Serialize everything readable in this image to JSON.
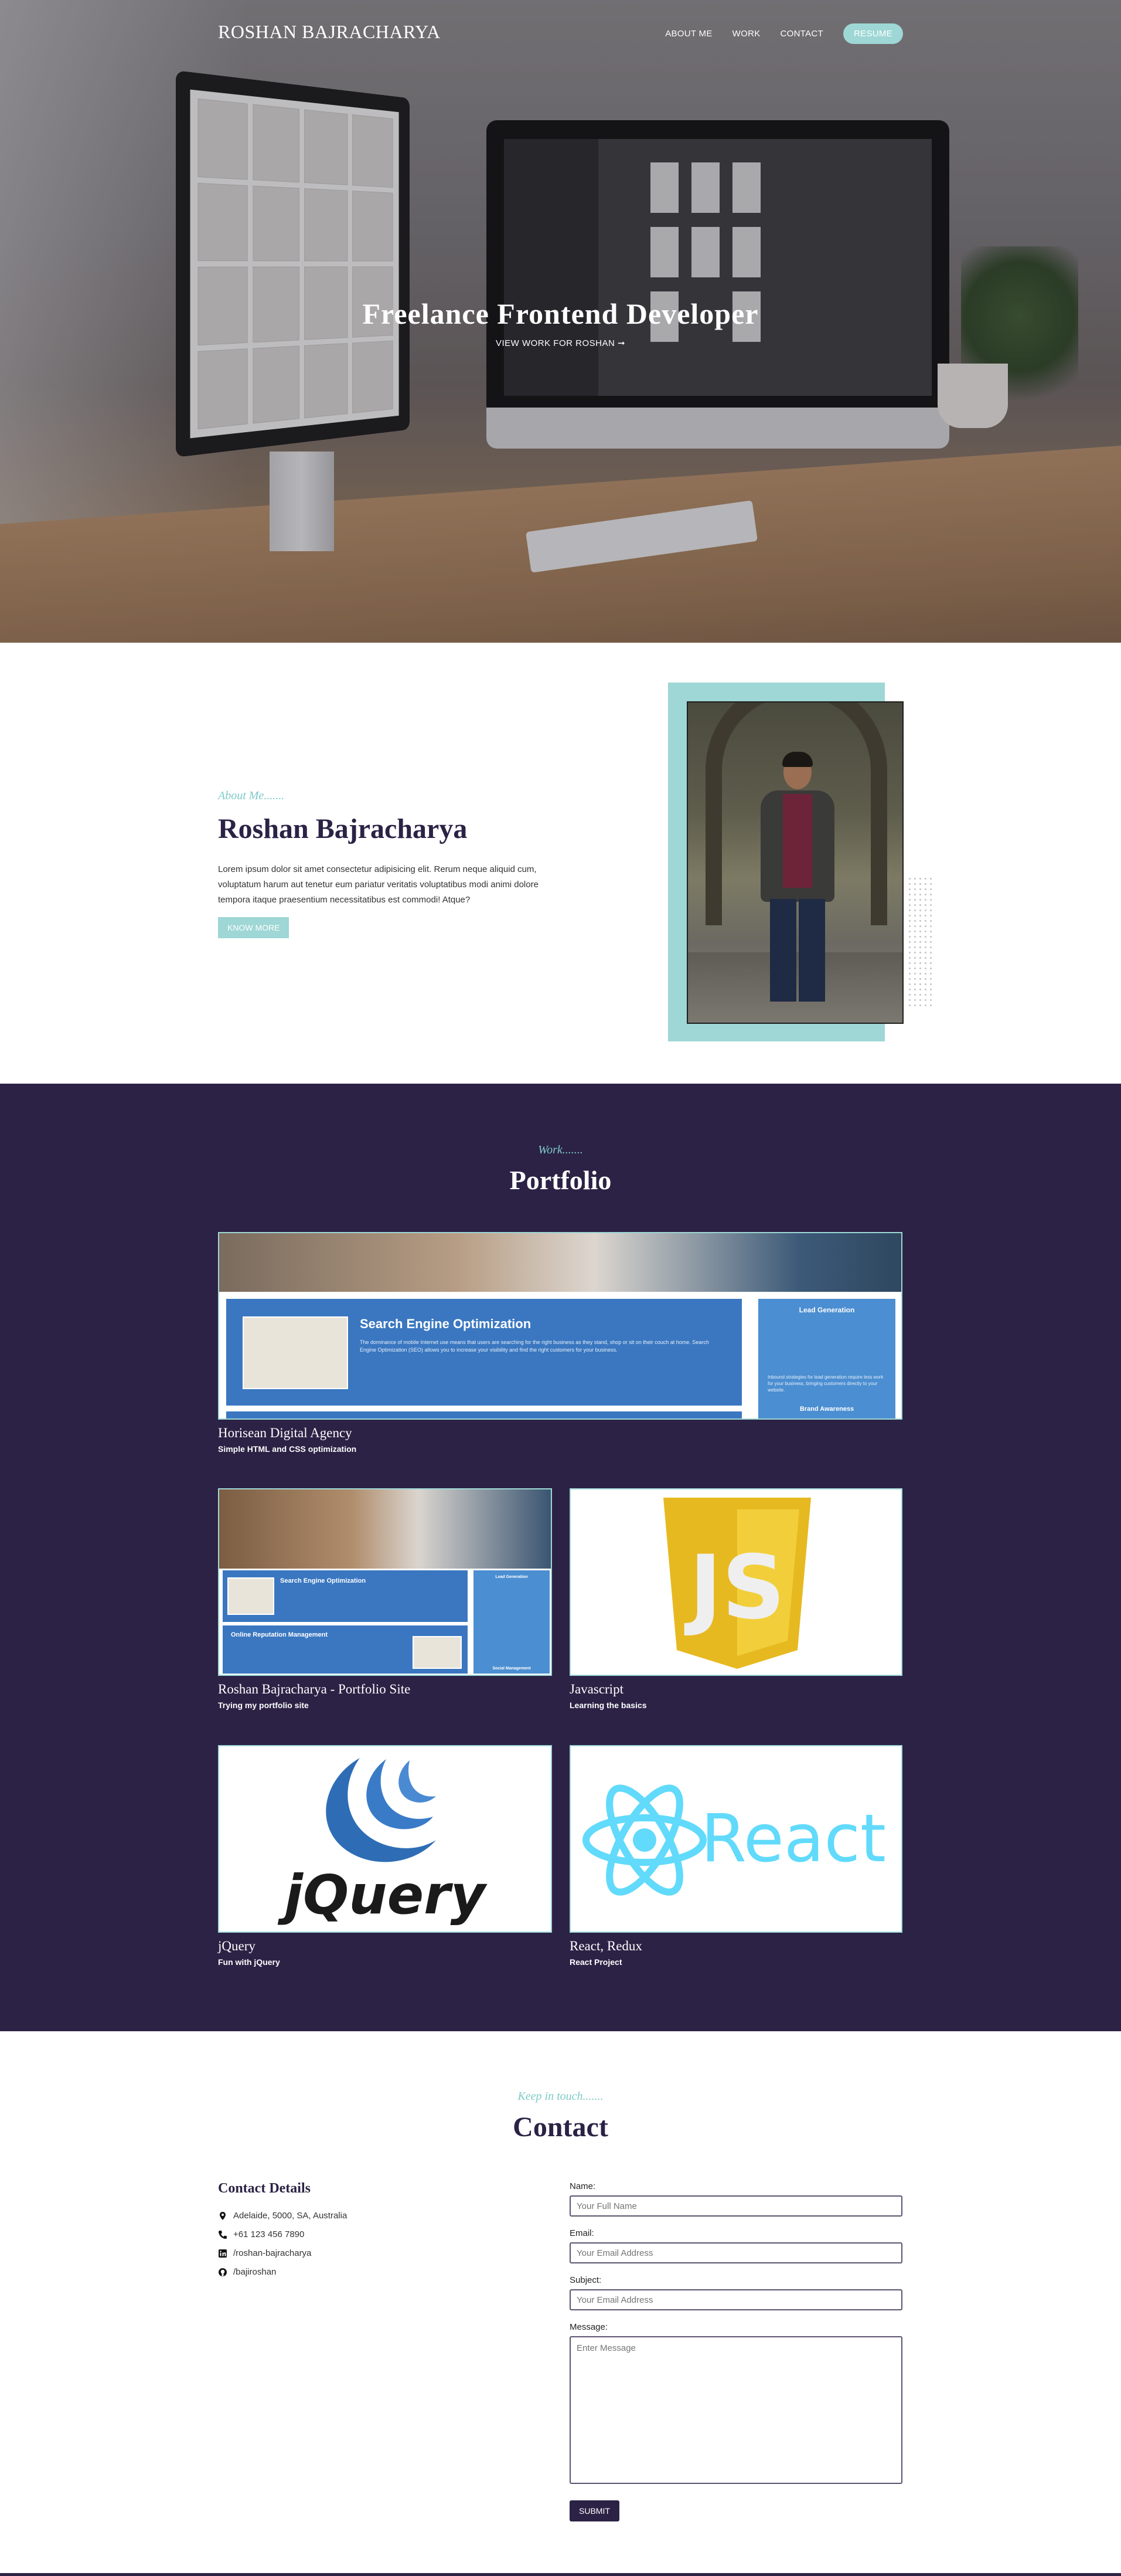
{
  "nav": {
    "brand": "ROSHAN BAJRACHARYA",
    "items": [
      "ABOUT ME",
      "WORK",
      "CONTACT"
    ],
    "resume": "RESUME"
  },
  "hero": {
    "title": "Freelance Frontend Developer",
    "subtitle": "VIEW WORK FOR ROSHAN ➞"
  },
  "about": {
    "kicker": "About Me.......",
    "name": "Roshan Bajracharya",
    "bio": "Lorem ipsum dolor sit amet consectetur adipisicing elit. Rerum neque aliquid cum, voluptatum harum aut tenetur eum pariatur veritatis voluptatibus modi animi dolore tempora itaque praesentium necessitatibus est commodi! Atque?",
    "button": "KNOW MORE"
  },
  "work": {
    "kicker": "Work.......",
    "title": "Portfolio",
    "projects": [
      {
        "title": "Horisean Digital Agency",
        "subtitle": "Simple HTML and CSS optimization"
      },
      {
        "title": "Roshan Bajracharya - Portfolio Site",
        "subtitle": "Trying my portfolio site"
      },
      {
        "title": "Javascript",
        "subtitle": "Learning the basics"
      },
      {
        "title": "jQuery",
        "subtitle": "Fun with jQuery"
      },
      {
        "title": "React, Redux",
        "subtitle": "React Project"
      }
    ],
    "thumb": {
      "seo_title": "Search Engine Optimization",
      "seo_text": "The dominance of mobile Internet use means that users are searching for the right business as they stand, shop or sit on their couch at home. Search Engine Optimization (SEO) allows you to increase your visibility and find the right customers for your business.",
      "lead_title": "Lead Generation",
      "lead_text": "Inbound strategies for lead generation require less work for your business, bringing customers directly to your website.",
      "brand_title": "Brand Awareness",
      "orm_title": "Online Reputation Management",
      "social_title": "Social Management",
      "js_text": "JS",
      "jquery_text": "jQuery",
      "react_text": "React"
    }
  },
  "contact": {
    "kicker": "Keep in touch.......",
    "title": "Contact",
    "details_heading": "Contact Details",
    "address": "Adelaide, 5000, SA, Australia",
    "phone": "+61 123 456 7890",
    "linkedin": "/roshan-bajracharya",
    "github": "/bajiroshan",
    "form": {
      "name_label": "Name:",
      "name_placeholder": "Your Full Name",
      "email_label": "Email:",
      "email_placeholder": "Your Email Address",
      "subject_label": "Subject:",
      "subject_placeholder": "Your Email Address",
      "message_label": "Message:",
      "message_placeholder": "Enter Message",
      "submit": "SUBMIT"
    }
  },
  "colors": {
    "accent_teal": "#9ed7d5",
    "navy": "#2b2245",
    "jquery_blue": "#0f6db4",
    "js_yellow": "#e7b920",
    "react_cyan": "#61dafb"
  }
}
